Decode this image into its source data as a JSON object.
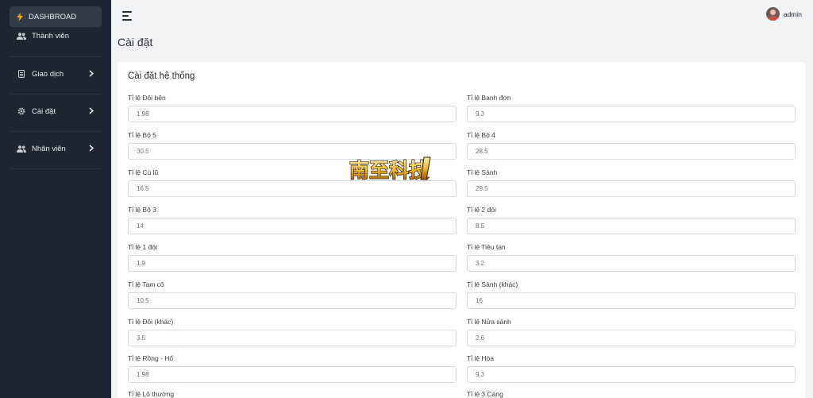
{
  "sidebar": {
    "items": [
      {
        "label": "DASHBROAD",
        "icon": "lightning-icon"
      },
      {
        "label": "Thành viên",
        "icon": "users-icon"
      },
      {
        "label": "Giao dịch",
        "icon": "document-icon"
      },
      {
        "label": "Cài đặt",
        "icon": "gear-icon"
      },
      {
        "label": "Nhân viên",
        "icon": "users-icon"
      }
    ]
  },
  "header": {
    "user_name": "admin"
  },
  "page": {
    "title": "Cài đặt"
  },
  "card": {
    "title": "Cài đặt hệ thống",
    "fields": [
      {
        "label": "Tỉ lệ Đôi bên",
        "value": "1.98"
      },
      {
        "label": "Tỉ lệ Banh đơn",
        "value": "9.3"
      },
      {
        "label": "Tỉ lệ Bộ 5",
        "value": "30.5"
      },
      {
        "label": "Tỉ lệ Bộ 4",
        "value": "28.5"
      },
      {
        "label": "Tỉ lệ Cù lũ",
        "value": "16.5"
      },
      {
        "label": "Tỉ lệ Sảnh",
        "value": "29.5"
      },
      {
        "label": "Tỉ lệ Bộ 3",
        "value": "14"
      },
      {
        "label": "Tỉ lệ 2 đôi",
        "value": "8.5"
      },
      {
        "label": "Tỉ lệ 1 đôi",
        "value": "1.9"
      },
      {
        "label": "Tỉ lệ Tiêu tan",
        "value": "3.2"
      },
      {
        "label": "Tỉ lệ Tam cô",
        "value": "10.5"
      },
      {
        "label": "Tỉ lệ Sảnh (khác)",
        "value": "16"
      },
      {
        "label": "Tỉ lệ Đôi (khác)",
        "value": "3.5"
      },
      {
        "label": "Tỉ lệ Nửa sảnh",
        "value": "2.6"
      },
      {
        "label": "Tỉ lệ Rồng - Hổ",
        "value": "1.98"
      },
      {
        "label": "Tỉ lệ Hòa",
        "value": "9.3"
      },
      {
        "label": "Tỉ lệ Lô thường",
        "value": ""
      },
      {
        "label": "Tỉ lệ 3 Càng",
        "value": ""
      }
    ]
  },
  "watermark": {
    "text": "南至科技"
  },
  "colors": {
    "sidebar_bg": "#1f2533",
    "sidebar_active": "#343b4b",
    "page_bg": "#f2f3f5",
    "accent": "#f5b301"
  }
}
